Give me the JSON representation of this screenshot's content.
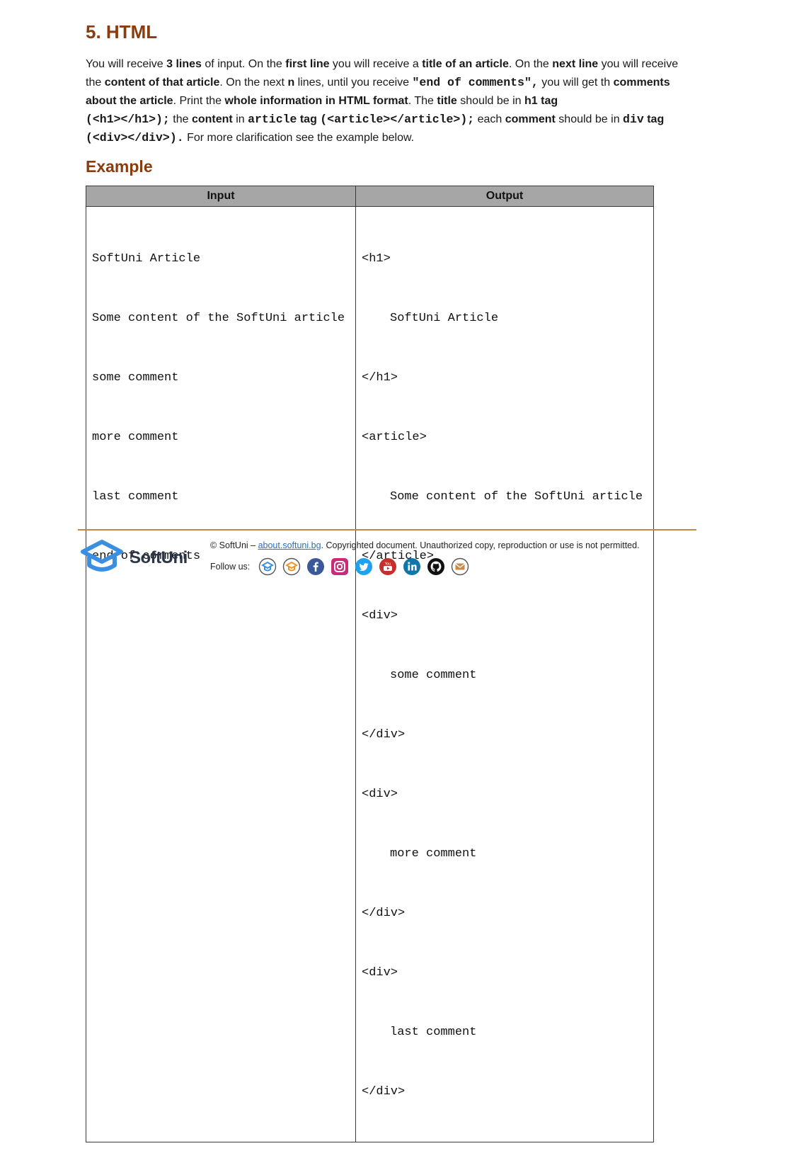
{
  "section_title": "5. HTML",
  "description": {
    "t1": "You will receive ",
    "b1": "3 lines",
    "t2": " of input. On the ",
    "b2": "first line",
    "t3": " you will receive a ",
    "b3": "title of an article",
    "t4": ". On the ",
    "b4": "next line",
    "t5": " you will receive the ",
    "b5": "content of that article",
    "t6": ". On the next ",
    "b6": "n",
    "t7": " lines, until you receive ",
    "c1": "\"end of comments\",",
    "t8": " you will get th ",
    "b7": "comments about the article",
    "t9": ". Print the ",
    "b8": "whole information in HTML format",
    "t10": ". The ",
    "b9": "title",
    "t11": " should be in ",
    "b10": "h1 tag",
    "c2": "(<h1></h1>);",
    "t12": " the ",
    "b11": "content",
    "t13": " in ",
    "c3": "article",
    "b12": " tag ",
    "c4": "(<article></article>);",
    "t14": " each ",
    "b13": "comment",
    "t15": " should be in ",
    "c5": "div",
    "b14": " tag",
    "c6": "(<div></div>).",
    "t16": " For more clarification see the example below."
  },
  "example_title": "Example",
  "table": {
    "headers": {
      "input": "Input",
      "output": "Output"
    },
    "input_lines": [
      "SoftUni Article",
      "Some content of the SoftUni article",
      "some comment",
      "more comment",
      "last comment",
      "end of comments"
    ],
    "output_lines": [
      "<h1>",
      "SoftUni Article",
      "</h1>",
      "<article>",
      "Some content of the SoftUni article",
      "</article>",
      "<div>",
      "some comment",
      "</div>",
      "<div>",
      "more comment",
      "</div>",
      "<div>",
      "last comment",
      "</div>"
    ]
  },
  "footer": {
    "brand": "SoftUni",
    "copyright_prefix": "© SoftUni – ",
    "copyright_link": "about.softuni.bg",
    "copyright_suffix": ". Copyrighted document. Unauthorized copy, reproduction or use is not permitted.",
    "follow_label": "Follow us:",
    "social_icons": [
      "softuni-icon",
      "softuni-kids-icon",
      "facebook-icon",
      "instagram-icon",
      "twitter-icon",
      "youtube-icon",
      "linkedin-icon",
      "github-icon",
      "email-icon"
    ]
  },
  "colors": {
    "heading": "#8a3c0e",
    "table_header": "#a6a6a6",
    "footer_rule": "#c8874a",
    "brand_blue": "#3b8fe0",
    "link": "#2f6cc0"
  }
}
